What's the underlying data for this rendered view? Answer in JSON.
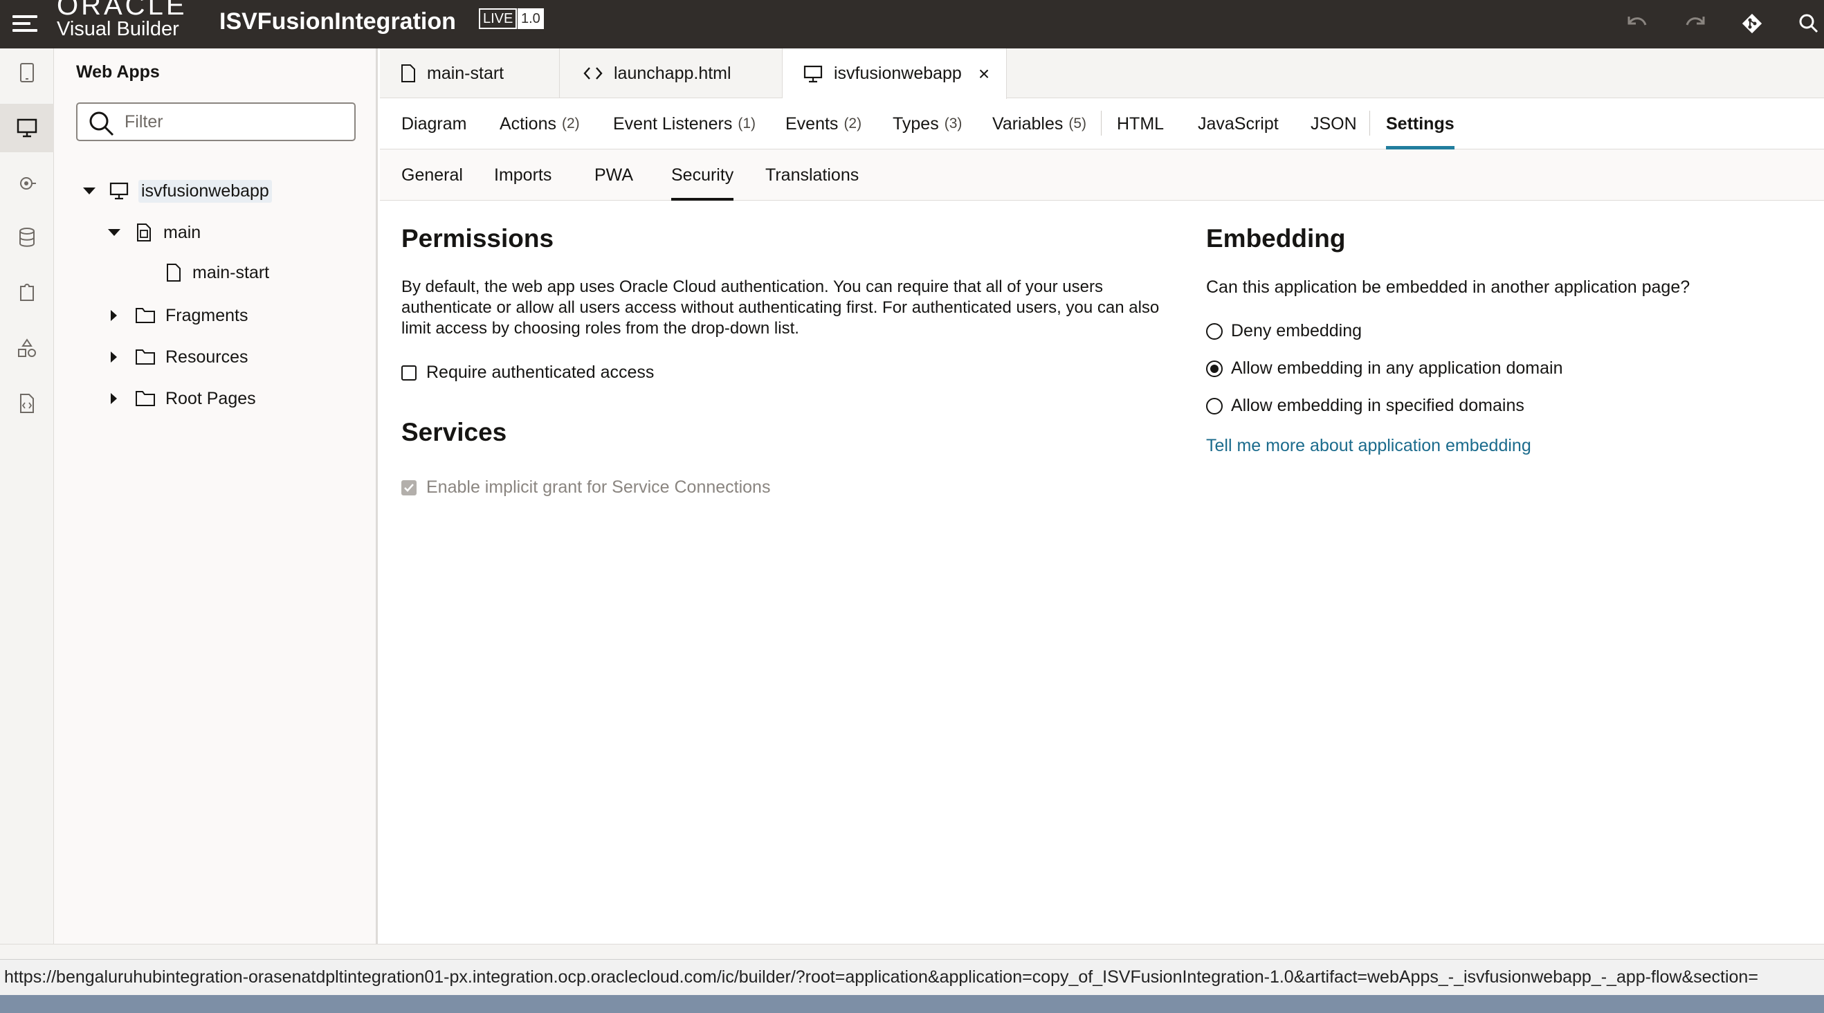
{
  "header": {
    "logo_line1": "ORACLE",
    "logo_line2": "Visual Builder",
    "app_name": "ISVFusionIntegration",
    "live_badge": "LIVE",
    "version_badge": "1.0"
  },
  "navigator": {
    "title": "Web Apps",
    "filter_placeholder": "Filter",
    "tree": {
      "root": "isvfusionwebapp",
      "main": "main",
      "main_start": "main-start",
      "fragments": "Fragments",
      "resources": "Resources",
      "root_pages": "Root Pages"
    }
  },
  "doc_tabs": [
    {
      "label": "main-start",
      "icon": "page-icon"
    },
    {
      "label": "launchapp.html",
      "icon": "code-icon"
    },
    {
      "label": "isvfusionwebapp",
      "icon": "monitor-icon",
      "close": "×"
    }
  ],
  "sub_tabs": {
    "diagram": "Diagram",
    "actions": "Actions",
    "actions_count": "(2)",
    "event_listeners": "Event Listeners",
    "event_listeners_count": "(1)",
    "events": "Events",
    "events_count": "(2)",
    "types": "Types",
    "types_count": "(3)",
    "variables": "Variables",
    "variables_count": "(5)",
    "html": "HTML",
    "javascript": "JavaScript",
    "json": "JSON",
    "settings": "Settings"
  },
  "section_tabs": {
    "general": "General",
    "imports": "Imports",
    "pwa": "PWA",
    "security": "Security",
    "translations": "Translations"
  },
  "permissions": {
    "title": "Permissions",
    "description": "By default, the web app uses Oracle Cloud authentication. You can require that all of your users authenticate or allow all users access without authenticating first. For authenticated users, you can also limit access by choosing roles from the drop-down list.",
    "require_auth_label": "Require authenticated access"
  },
  "services": {
    "title": "Services",
    "implicit_grant_label": "Enable implicit grant for Service Connections"
  },
  "embedding": {
    "title": "Embedding",
    "question": "Can this application be embedded in another application page?",
    "options": [
      "Deny embedding",
      "Allow embedding in any application domain",
      "Allow embedding in specified domains"
    ],
    "selected": "Allow embedding in any application domain",
    "more_link": "Tell me more about application embedding"
  },
  "status_url": "https://bengaluruhubintegration-orasenatdpltintegration01-px.integration.ocp.oraclecloud.com/ic/builder/?root=application&application=copy_of_ISVFusionIntegration-1.0&artifact=webApps_-_isvfusionwebapp_-_app-flow&section=",
  "colors": {
    "header_bg": "#312d2a",
    "accent": "#227e9e",
    "link": "#1b6b8c"
  }
}
